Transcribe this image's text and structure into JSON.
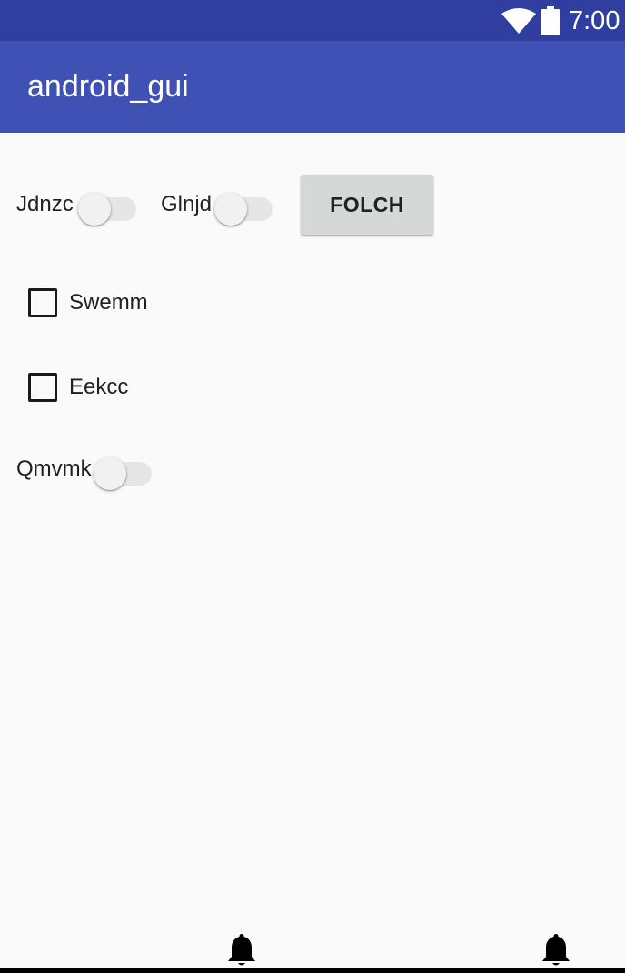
{
  "status_bar": {
    "time": "7:00",
    "icons": [
      "wifi-icon",
      "battery-icon"
    ],
    "background": "#303f9f"
  },
  "app_bar": {
    "title": "android_gui",
    "background": "#3f51b5"
  },
  "content": {
    "switch_1_label": "Jdnzc",
    "switch_2_label": "Glnjd",
    "button_label": "FOLCH",
    "checkbox_1_label": "Swemm",
    "checkbox_2_label": "Eekcc",
    "switch_3_label": "Qmvmk"
  },
  "bottom_nav": {
    "icons": [
      "bell-icon",
      "bell-icon"
    ]
  }
}
